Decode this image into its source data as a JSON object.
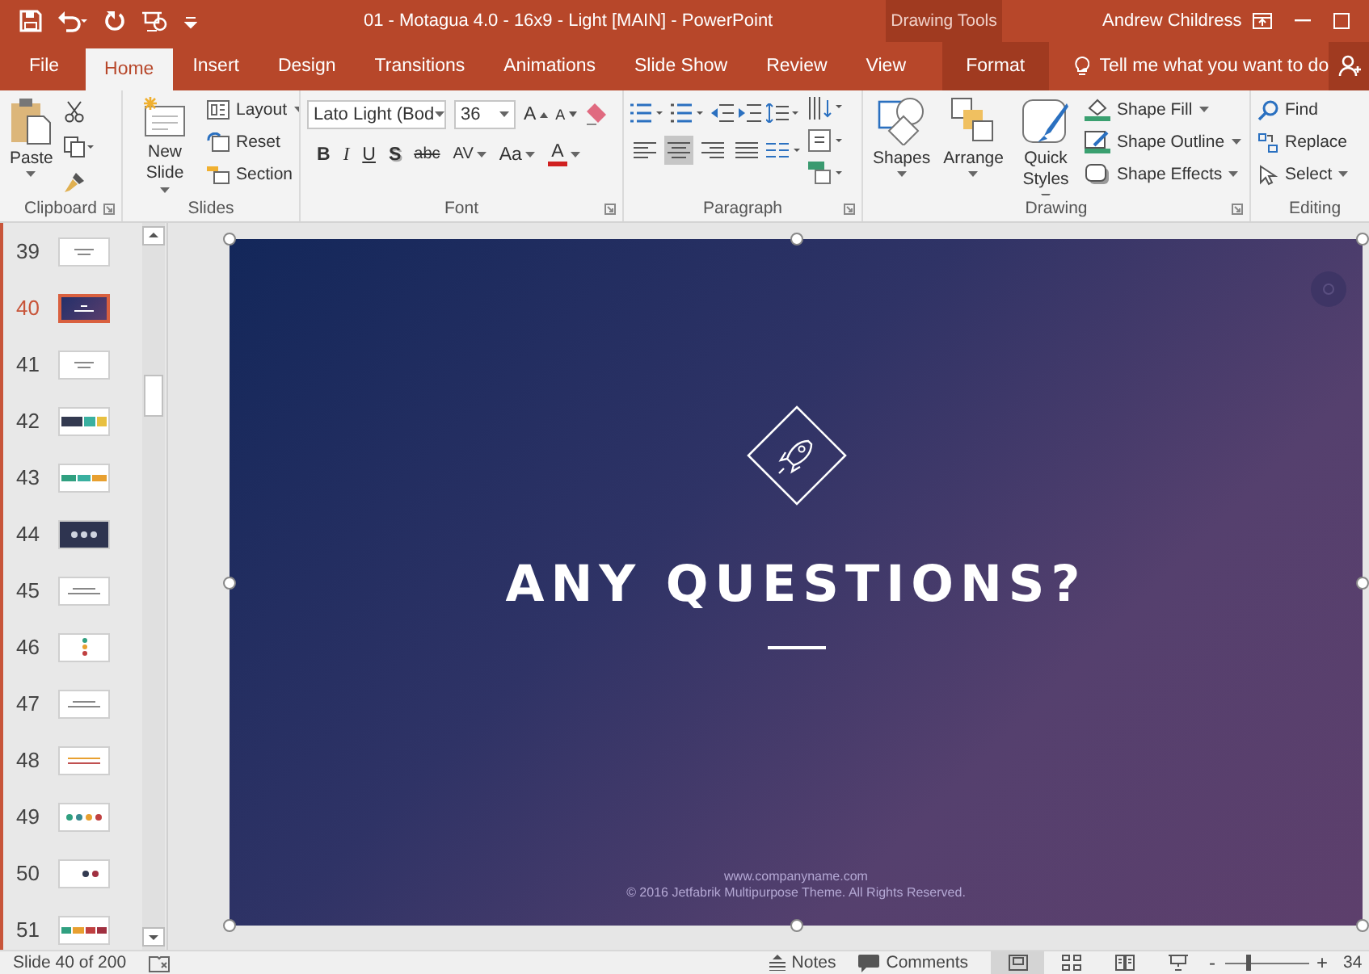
{
  "window": {
    "title": "01 - Motagua 4.0 - 16x9 - Light [MAIN]  -  PowerPoint",
    "context_label": "Drawing Tools",
    "user": "Andrew Childress"
  },
  "tabs": [
    {
      "label": "File",
      "kind": "file",
      "selected": false
    },
    {
      "label": "Home",
      "kind": "tab",
      "selected": true
    },
    {
      "label": "Insert",
      "kind": "tab",
      "selected": false
    },
    {
      "label": "Design",
      "kind": "tab",
      "selected": false
    },
    {
      "label": "Transitions",
      "kind": "tab",
      "selected": false
    },
    {
      "label": "Animations",
      "kind": "tab",
      "selected": false
    },
    {
      "label": "Slide Show",
      "kind": "tab",
      "selected": false
    },
    {
      "label": "Review",
      "kind": "tab",
      "selected": false
    },
    {
      "label": "View",
      "kind": "tab",
      "selected": false
    },
    {
      "label": "Format",
      "kind": "context",
      "selected": false
    }
  ],
  "tell_me": {
    "placeholder": "Tell me what you want to do"
  },
  "ribbon": {
    "clipboard": {
      "label": "Clipboard",
      "paste": "Paste"
    },
    "slides": {
      "label": "Slides",
      "new_slide": "New Slide",
      "layout": "Layout",
      "reset": "Reset",
      "section": "Section"
    },
    "font": {
      "label": "Font",
      "font_name": "Lato Light (Bod",
      "font_size": "36",
      "grow": "A",
      "shrink": "A",
      "bold": "B",
      "italic": "I",
      "underline": "U",
      "shadow": "S",
      "strike": "abc",
      "spacing": "AV",
      "case": "Aa",
      "font_color_button": "A"
    },
    "paragraph": {
      "label": "Paragraph",
      "alignments": [
        {
          "kind": "left",
          "selected": false
        },
        {
          "kind": "center",
          "selected": true
        },
        {
          "kind": "right",
          "selected": false
        },
        {
          "kind": "justify",
          "selected": false
        }
      ]
    },
    "drawing": {
      "label": "Drawing",
      "shapes": "Shapes",
      "arrange": "Arrange",
      "quick_styles": "Quick Styles",
      "shape_fill": "Shape Fill",
      "shape_outline": "Shape Outline",
      "shape_effects": "Shape Effects"
    },
    "editing": {
      "label": "Editing",
      "find": "Find",
      "replace": "Replace",
      "select": "Select"
    }
  },
  "slides": [
    {
      "number": "39",
      "kind": "text",
      "selected": false
    },
    {
      "number": "40",
      "kind": "purple",
      "selected": true
    },
    {
      "number": "41",
      "kind": "text",
      "selected": false
    },
    {
      "number": "42",
      "kind": "panels",
      "selected": false
    },
    {
      "number": "43",
      "kind": "bands",
      "selected": false
    },
    {
      "number": "44",
      "kind": "dark",
      "selected": false
    },
    {
      "number": "45",
      "kind": "grid",
      "selected": false
    },
    {
      "number": "46",
      "kind": "list",
      "selected": false
    },
    {
      "number": "47",
      "kind": "grid",
      "selected": false
    },
    {
      "number": "48",
      "kind": "rows",
      "selected": false
    },
    {
      "number": "49",
      "kind": "circles",
      "selected": false
    },
    {
      "number": "50",
      "kind": "pair",
      "selected": false
    },
    {
      "number": "51",
      "kind": "blocks",
      "selected": false
    }
  ],
  "slide": {
    "title": "ANY QUESTIONS?",
    "website": "www.companyname.com",
    "copyright": "© 2016 Jetfabrik Multipurpose Theme. All Rights Reserved."
  },
  "status_bar": {
    "slide_info": "Slide 40 of 200",
    "notes": "Notes",
    "comments": "Comments",
    "views": [
      {
        "kind": "normal",
        "selected": true
      },
      {
        "kind": "sorter",
        "selected": false
      },
      {
        "kind": "reading",
        "selected": false
      },
      {
        "kind": "slideshow",
        "selected": false
      }
    ],
    "zoom": {
      "zoom_out": "-",
      "level": 0.27,
      "zoom_in": "+",
      "reading": "34"
    }
  }
}
